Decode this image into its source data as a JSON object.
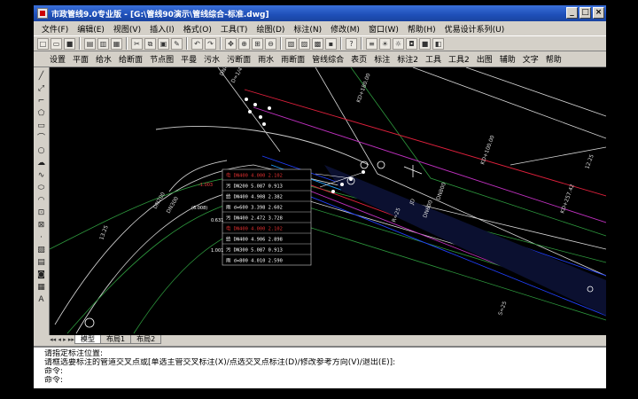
{
  "window": {
    "title": "市政管线9.0专业版 - [G:\\管线90演示\\管线综合-标准.dwg]",
    "buttons": [
      "_",
      "□",
      "×"
    ]
  },
  "menu": [
    "文件(F)",
    "编辑(E)",
    "视图(V)",
    "插入(I)",
    "格式(O)",
    "工具(T)",
    "绘图(D)",
    "标注(N)",
    "修改(M)",
    "窗口(W)",
    "帮助(H)",
    "优易设计系列(U)"
  ],
  "toolbar2": [
    "设置",
    "平面",
    "给水",
    "给断面",
    "节点图",
    "平曼",
    "污水",
    "污断面",
    "雨水",
    "雨断面",
    "管线综合",
    "表页",
    "标注",
    "标注2",
    "工具",
    "工具2",
    "出图",
    "辅助",
    "文字",
    "帮助"
  ],
  "drawing": {
    "road_labels": [
      "DN400",
      "D=1/4",
      "DN200",
      "DN300",
      "KD+180.00",
      "KD+100.00",
      "JD",
      "R=25",
      "KD+257.42",
      "12.25",
      "13.25",
      "DN800",
      "DN600",
      "S=25"
    ],
    "table_rows": [
      {
        "text": "电 DN400 4.000 2.102",
        "hl": true
      },
      {
        "text": "污 DN200 5.087 0.913",
        "hl": false
      },
      {
        "text": "给 DN400 4.908 2.382",
        "hl": false
      },
      {
        "text": "雨 d=600 3.398 2.602",
        "hl": false
      },
      {
        "text": "污 DN400 2.472 3.728",
        "hl": false
      },
      {
        "text": "电 DN400 4.000 2.102",
        "hl": true
      },
      {
        "text": "给 DN400 4.906 2.898",
        "hl": false
      },
      {
        "text": "污 DN300 5.087 0.913",
        "hl": false
      },
      {
        "text": "雨 d=800 4.010 2.590",
        "hl": false
      }
    ],
    "side_labels": [
      "-1.003",
      "(6.008)",
      "0.631",
      "1.001"
    ]
  },
  "tabs": [
    "模型",
    "布局1",
    "布局2"
  ],
  "command": {
    "line1": "请指定标注位置:",
    "line2": "请框选要标注的管道交叉点或[单选主管交叉标注(X)/点选交叉点标注(D)/修改参考方向(V)/退出(E)]:",
    "line3": "命令:",
    "line4": "命令:"
  }
}
